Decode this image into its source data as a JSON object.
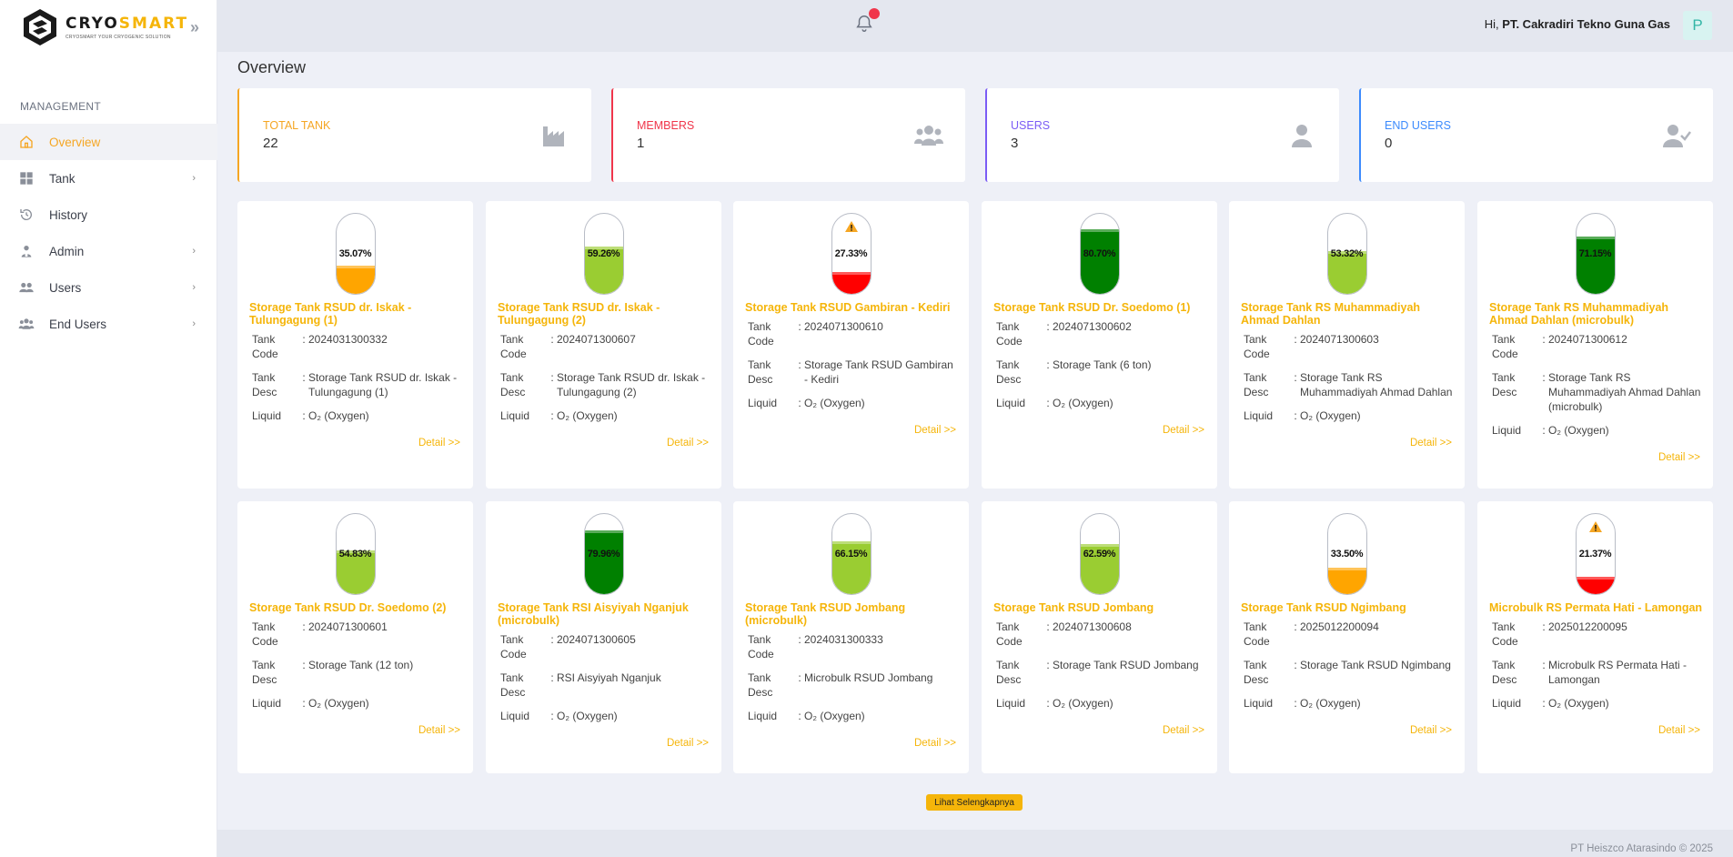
{
  "brand": {
    "name_part1": "CRYO",
    "name_part2": "SMART",
    "tagline": "CRYOSMART YOUR CRYOGENIC SOLUTION",
    "arrows": "»"
  },
  "sidebar": {
    "section_label": "MANAGEMENT",
    "items": [
      {
        "label": "Overview",
        "icon": "home-icon",
        "active": true,
        "has_children": false
      },
      {
        "label": "Tank",
        "icon": "grid-icon",
        "active": false,
        "has_children": true
      },
      {
        "label": "History",
        "icon": "history-icon",
        "active": false,
        "has_children": false
      },
      {
        "label": "Admin",
        "icon": "admin-icon",
        "active": false,
        "has_children": true
      },
      {
        "label": "Users",
        "icon": "users-icon",
        "active": false,
        "has_children": true
      },
      {
        "label": "End Users",
        "icon": "end-users-icon",
        "active": false,
        "has_children": true
      }
    ]
  },
  "topbar": {
    "greeting_prefix": "Hi, ",
    "user_name": "PT. Cakradiri Tekno Guna Gas",
    "avatar_letter": "P",
    "notification_icon": "bell-icon",
    "has_notification": true
  },
  "page_title": "Overview",
  "stats": [
    {
      "label": "TOTAL TANK",
      "value": "22",
      "color": "#f5a623",
      "icon": "factory-icon"
    },
    {
      "label": "MEMBERS",
      "value": "1",
      "color": "#f0364b",
      "icon": "group-icon"
    },
    {
      "label": "USERS",
      "value": "3",
      "color": "#7b5cf5",
      "icon": "user-icon"
    },
    {
      "label": "END USERS",
      "value": "0",
      "color": "#3d8bfd",
      "icon": "user-check-icon"
    }
  ],
  "field_labels": {
    "code": "Tank Code",
    "desc": "Tank Desc",
    "liquid": "Liquid",
    "colon": ":",
    "detail": "Detail >>"
  },
  "tanks": [
    {
      "percent": 35.07,
      "percent_label": "35.07%",
      "color": "#ffa500",
      "warning": false,
      "name": "Storage Tank RSUD dr. Iskak - Tulungagung (1)",
      "code": "2024031300332",
      "desc": "Storage Tank RSUD dr. Iskak - Tulungagung (1)",
      "liquid": "O₂ (Oxygen)"
    },
    {
      "percent": 59.26,
      "percent_label": "59.26%",
      "color": "#9acd32",
      "warning": false,
      "name": "Storage Tank RSUD dr. Iskak - Tulungagung (2)",
      "code": "2024071300607",
      "desc": "Storage Tank RSUD dr. Iskak - Tulungagung (2)",
      "liquid": "O₂ (Oxygen)"
    },
    {
      "percent": 27.33,
      "percent_label": "27.33%",
      "color": "#ff0000",
      "warning": true,
      "name": "Storage Tank RSUD Gambiran - Kediri",
      "code": "2024071300610",
      "desc": "Storage Tank RSUD Gambiran - Kediri",
      "liquid": "O₂ (Oxygen)"
    },
    {
      "percent": 80.7,
      "percent_label": "80.70%",
      "color": "#008000",
      "warning": false,
      "name": "Storage Tank RSUD Dr. Soedomo (1)",
      "code": "2024071300602",
      "desc": "Storage Tank (6 ton)",
      "liquid": "O₂ (Oxygen)"
    },
    {
      "percent": 53.32,
      "percent_label": "53.32%",
      "color": "#9acd32",
      "warning": false,
      "name": "Storage Tank RS Muhammadiyah Ahmad Dahlan",
      "code": "2024071300603",
      "desc": "Storage Tank RS Muhammadiyah Ahmad Dahlan",
      "liquid": "O₂ (Oxygen)"
    },
    {
      "percent": 71.15,
      "percent_label": "71.15%",
      "color": "#008000",
      "warning": false,
      "name": "Storage Tank RS Muhammadiyah Ahmad Dahlan (microbulk)",
      "code": "2024071300612",
      "desc": "Storage Tank RS Muhammadiyah Ahmad Dahlan (microbulk)",
      "liquid": "O₂ (Oxygen)"
    },
    {
      "percent": 54.83,
      "percent_label": "54.83%",
      "color": "#9acd32",
      "warning": false,
      "name": "Storage Tank RSUD Dr. Soedomo (2)",
      "code": "2024071300601",
      "desc": "Storage Tank (12 ton)",
      "liquid": "O₂ (Oxygen)"
    },
    {
      "percent": 79.96,
      "percent_label": "79.96%",
      "color": "#008000",
      "warning": false,
      "name": "Storage Tank RSI Aisyiyah Nganjuk (microbulk)",
      "code": "2024071300605",
      "desc": "RSI Aisyiyah Nganjuk",
      "liquid": "O₂ (Oxygen)"
    },
    {
      "percent": 66.15,
      "percent_label": "66.15%",
      "color": "#9acd32",
      "warning": false,
      "name": "Storage Tank RSUD Jombang (microbulk)",
      "code": "2024031300333",
      "desc": "Microbulk RSUD Jombang",
      "liquid": "O₂ (Oxygen)"
    },
    {
      "percent": 62.59,
      "percent_label": "62.59%",
      "color": "#9acd32",
      "warning": false,
      "name": "Storage Tank RSUD Jombang",
      "code": "2024071300608",
      "desc": "Storage Tank RSUD Jombang",
      "liquid": "O₂ (Oxygen)"
    },
    {
      "percent": 33.5,
      "percent_label": "33.50%",
      "color": "#ffa500",
      "warning": false,
      "name": "Storage Tank RSUD Ngimbang",
      "code": "2025012200094",
      "desc": "Storage Tank RSUD Ngimbang",
      "liquid": "O₂ (Oxygen)"
    },
    {
      "percent": 21.37,
      "percent_label": "21.37%",
      "color": "#ff0000",
      "warning": true,
      "name": "Microbulk RS Permata Hati - Lamongan",
      "code": "2025012200095",
      "desc": "Microbulk RS Permata Hati - Lamongan",
      "liquid": "O₂ (Oxygen)"
    }
  ],
  "load_more_label": "Lihat Selengkapnya",
  "footer": "PT Heiszco Atarasindo © 2025"
}
